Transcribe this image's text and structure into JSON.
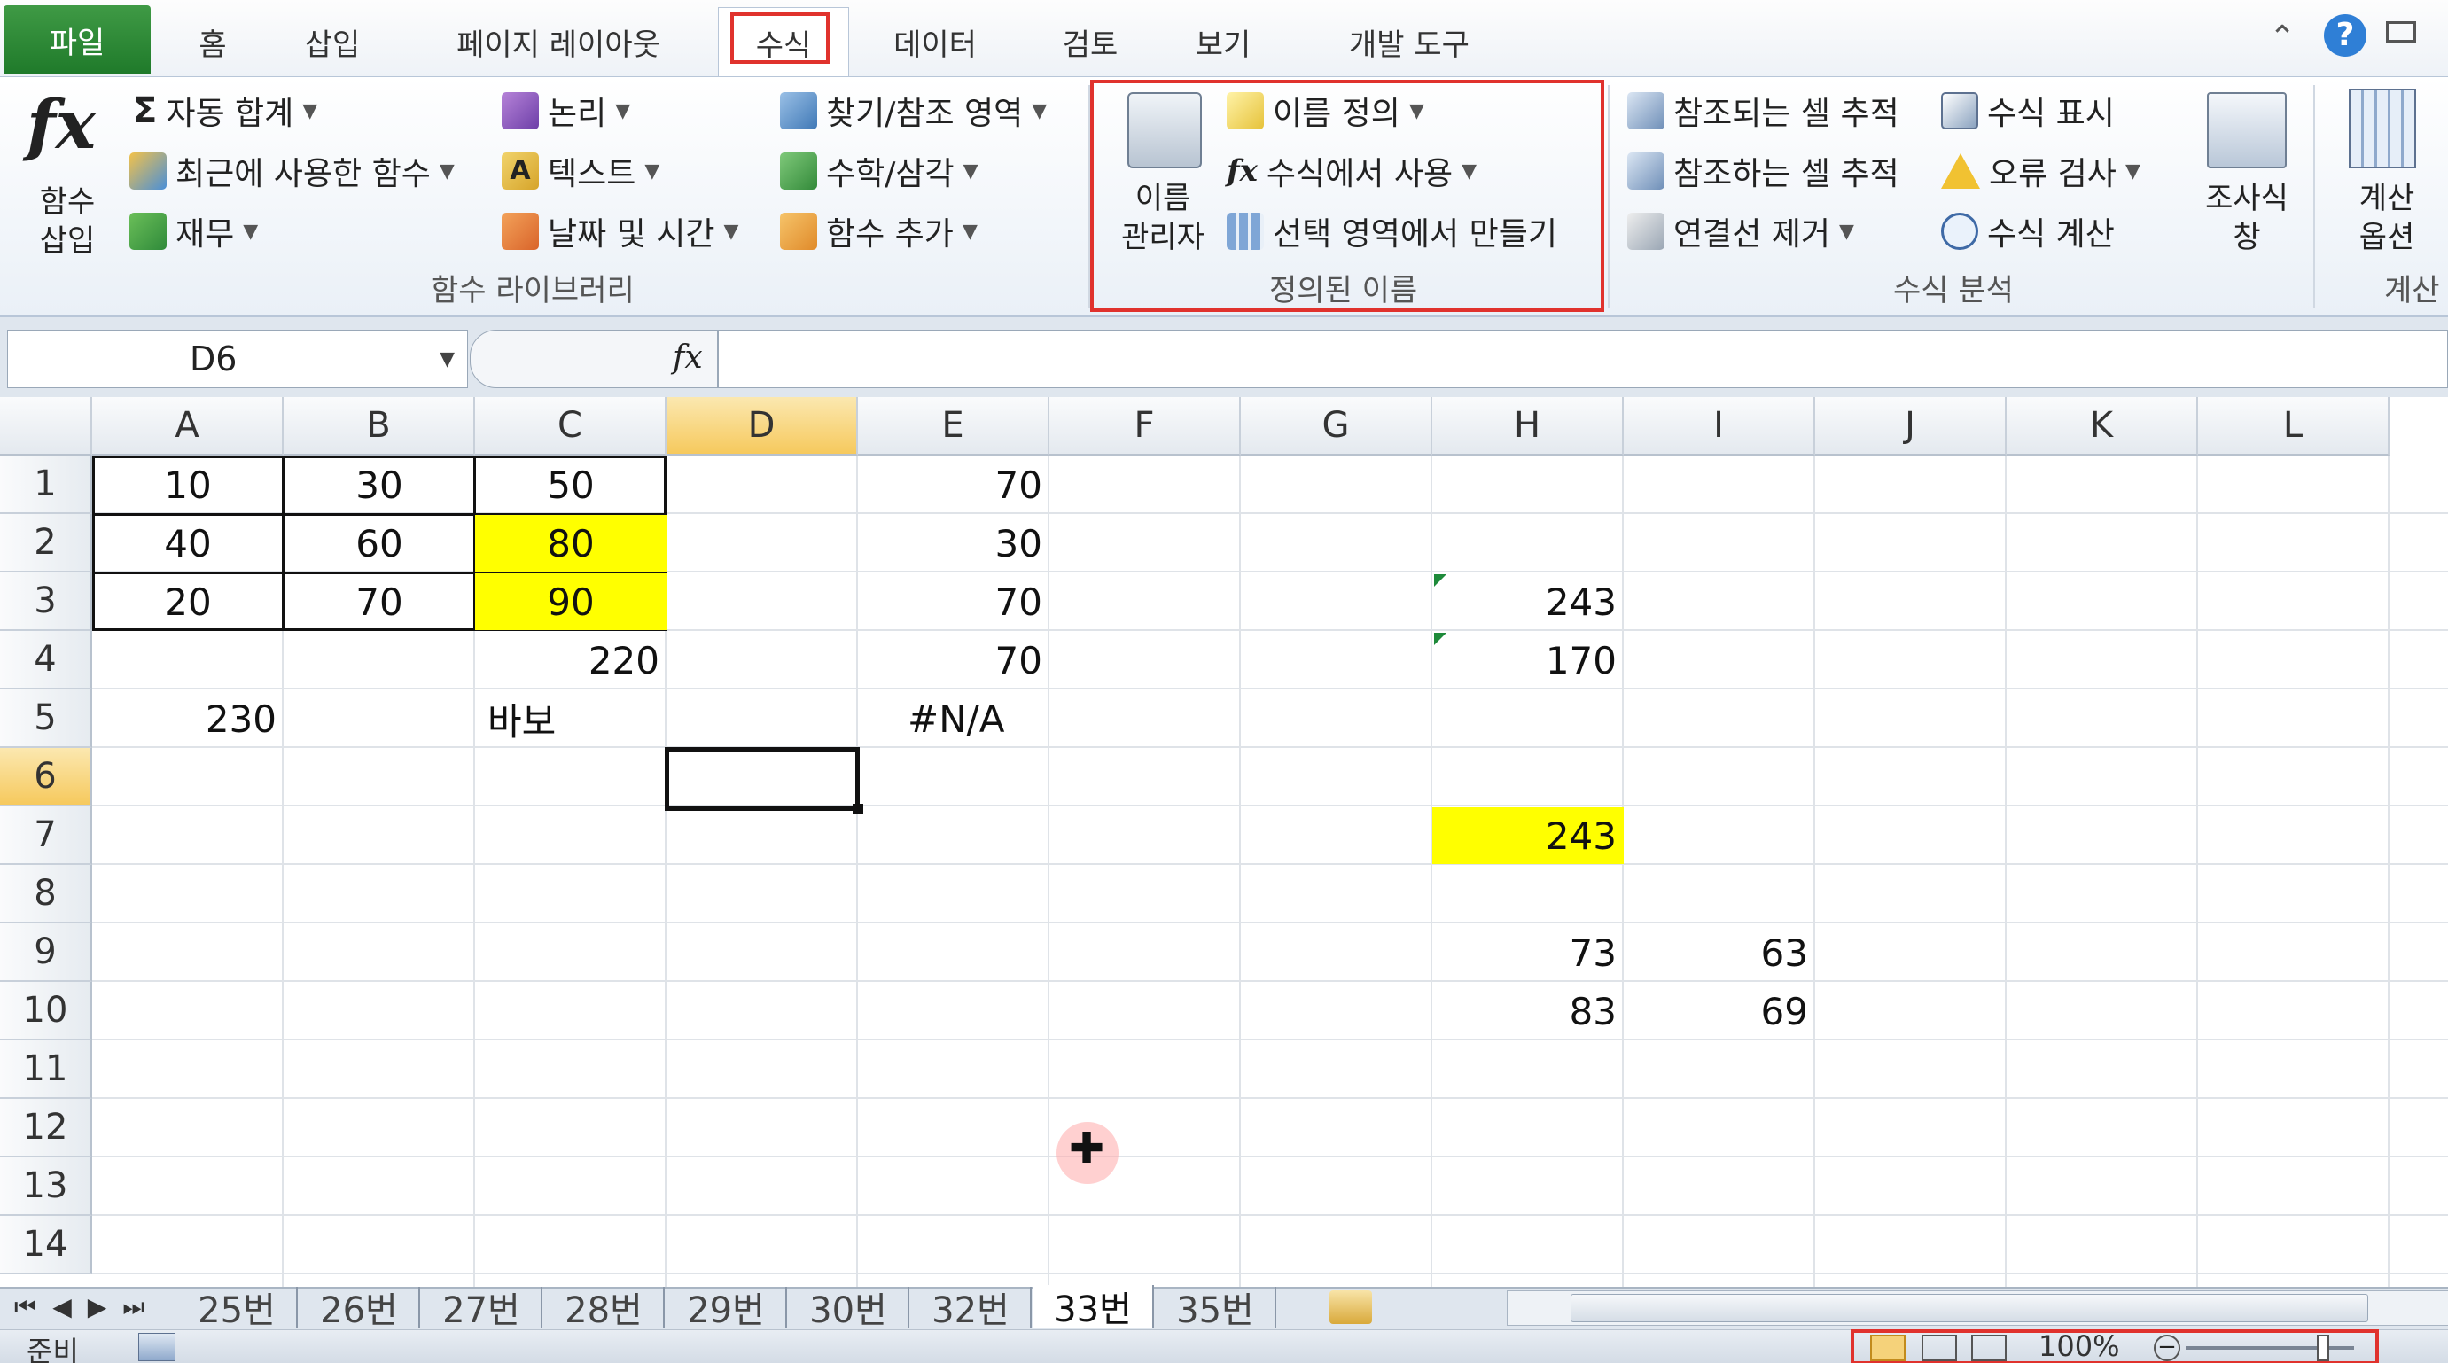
{
  "tabs": [
    "파일",
    "홈",
    "삽입",
    "페이지 레이아웃",
    "수식",
    "데이터",
    "검토",
    "보기",
    "개발 도구"
  ],
  "ribbon": {
    "insert_function": [
      "함수",
      "삽입"
    ],
    "autosum": "자동 합계",
    "recent": "최근에 사용한 함수",
    "financial": "재무",
    "logical": "논리",
    "text": "텍스트",
    "datetime": "날짜 및 시간",
    "lookup": "찾기/참조 영역",
    "math": "수학/삼각",
    "more": "함수 추가",
    "group_library": "함수 라이브러리",
    "name_manager": [
      "이름",
      "관리자"
    ],
    "define_name": "이름 정의",
    "use_in_formula": "수식에서 사용",
    "create_from_sel": "선택 영역에서 만들기",
    "group_names": "정의된 이름",
    "trace_precedents": "참조되는 셀 추적",
    "trace_dependents": "참조하는 셀 추적",
    "remove_arrows": "연결선 제거",
    "show_formulas": "수식 표시",
    "error_check": "오류 검사",
    "evaluate": "수식 계산",
    "watch": [
      "조사식",
      "창"
    ],
    "group_audit": "수식 분석",
    "calc_options": [
      "계산",
      "옵션"
    ],
    "group_calc": "계산"
  },
  "formula_bar": {
    "name_box": "D6",
    "fx": "fx",
    "formula": ""
  },
  "columns": [
    "A",
    "B",
    "C",
    "D",
    "E",
    "F",
    "G",
    "H",
    "I",
    "J",
    "K",
    "L"
  ],
  "rows": [
    "1",
    "2",
    "3",
    "4",
    "5",
    "6",
    "7",
    "8",
    "9",
    "10",
    "11",
    "12",
    "13",
    "14"
  ],
  "cells": {
    "A1": "10",
    "B1": "30",
    "C1": "50",
    "E1": "70",
    "A2": "40",
    "B2": "60",
    "C2": "80",
    "E2": "30",
    "A3": "20",
    "B3": "70",
    "C3": "90",
    "E3": "70",
    "H3": "243",
    "C4": "220",
    "E4": "70",
    "H4": "170",
    "A5": "230",
    "C5": "바보",
    "E5": "#N/A",
    "H7": "243",
    "H9": "73",
    "I9": "63",
    "H10": "83",
    "I10": "69"
  },
  "sheet_tabs": [
    "25번",
    "26번",
    "27번",
    "28번",
    "29번",
    "30번",
    "32번",
    "33번",
    "35번"
  ],
  "active_sheet": "33번",
  "status": {
    "ready": "준비",
    "zoom": "100%"
  },
  "colors": {
    "highlight": "#ffff00",
    "accent_red": "#e0322d",
    "file_tab": "#217a2c"
  }
}
